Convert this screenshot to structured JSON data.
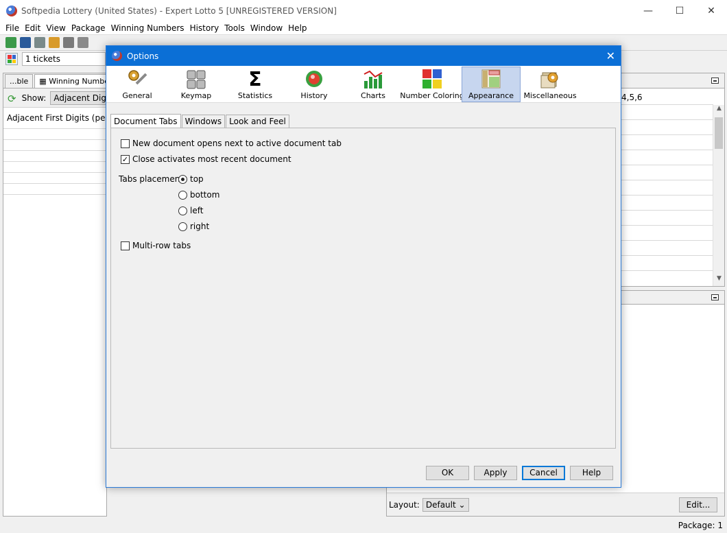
{
  "window": {
    "title": "Softpedia Lottery (United States) - Expert Lotto 5 [UNREGISTERED VERSION]"
  },
  "menu": [
    "File",
    "Edit",
    "View",
    "Package",
    "Winning Numbers",
    "History",
    "Tools",
    "Window",
    "Help"
  ],
  "toolbar2": {
    "tickets": "1 tickets"
  },
  "left_panel": {
    "tabs": [
      {
        "label": "...ble"
      },
      {
        "label": "Winning Numbers"
      }
    ],
    "show_label": "Show:",
    "show_value": "Adjacent Digits",
    "grid_header": "Adjacent First Digits (per ticket)"
  },
  "right_panel": {
    "numbers": "4,5,6",
    "layout_label": "Layout:",
    "layout_value": "Default",
    "edit_label": "Edit..."
  },
  "status": {
    "package": "Package: 1"
  },
  "dialog": {
    "title": "Options",
    "categories": [
      {
        "label": "General"
      },
      {
        "label": "Keymap"
      },
      {
        "label": "Statistics"
      },
      {
        "label": "History"
      },
      {
        "label": "Charts"
      },
      {
        "label": "Number Coloring"
      },
      {
        "label": "Appearance"
      },
      {
        "label": "Miscellaneous"
      }
    ],
    "active_category": "Appearance",
    "tabs": [
      {
        "label": "Document Tabs"
      },
      {
        "label": "Windows"
      },
      {
        "label": "Look and Feel"
      }
    ],
    "options": {
      "new_doc": {
        "label": "New document opens next to active document tab",
        "checked": false
      },
      "close_recent": {
        "label": "Close activates most recent document",
        "checked": true
      },
      "tabs_placement_label": "Tabs placement:",
      "placements": [
        {
          "label": "top",
          "selected": true
        },
        {
          "label": "bottom",
          "selected": false
        },
        {
          "label": "left",
          "selected": false
        },
        {
          "label": "right",
          "selected": false
        }
      ],
      "multirow": {
        "label": "Multi-row tabs",
        "checked": false
      }
    },
    "buttons": {
      "ok": "OK",
      "apply": "Apply",
      "cancel": "Cancel",
      "help": "Help"
    }
  }
}
